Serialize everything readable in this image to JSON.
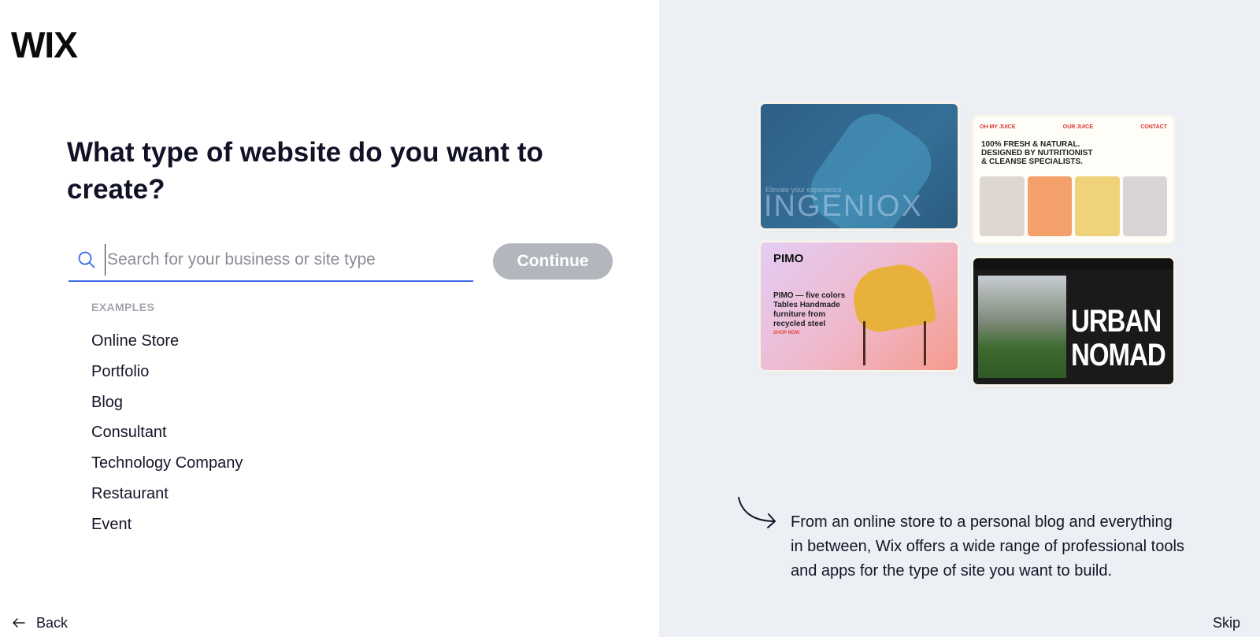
{
  "brand": {
    "logo": "WIX"
  },
  "main": {
    "headline": "What type of website do you want to create?",
    "search": {
      "placeholder": "Search for your business or site type",
      "value": ""
    },
    "continue_label": "Continue",
    "examples_label": "EXAMPLES",
    "examples": [
      "Online Store",
      "Portfolio",
      "Blog",
      "Consultant",
      "Technology Company",
      "Restaurant",
      "Event"
    ]
  },
  "footer": {
    "back_label": "Back",
    "skip_label": "Skip"
  },
  "preview": {
    "templates": [
      {
        "name": "INGENIOX",
        "subtitle": "Elevate your experience"
      },
      {
        "name": "OH MY JUICE",
        "nav": "OUR JUICE",
        "contact": "CONTACT",
        "headline": "100% FRESH & NATURAL. DESIGNED BY NUTRITIONIST & CLEANSE SPECIALISTS."
      },
      {
        "name": "PIMO",
        "headline": "PIMO — five colors Tables Handmade furniture from recycled steel",
        "cta": "SHOP NOW"
      },
      {
        "name": "URBAN NOMAD"
      }
    ],
    "blurb": "From an online store to a personal blog and everything in between, Wix offers a wide range of professional tools and apps for the type of site you want to build."
  },
  "colors": {
    "accent": "#3b6ce6",
    "button_disabled": "#b3b6bd",
    "panel_bg": "#eceff4"
  }
}
